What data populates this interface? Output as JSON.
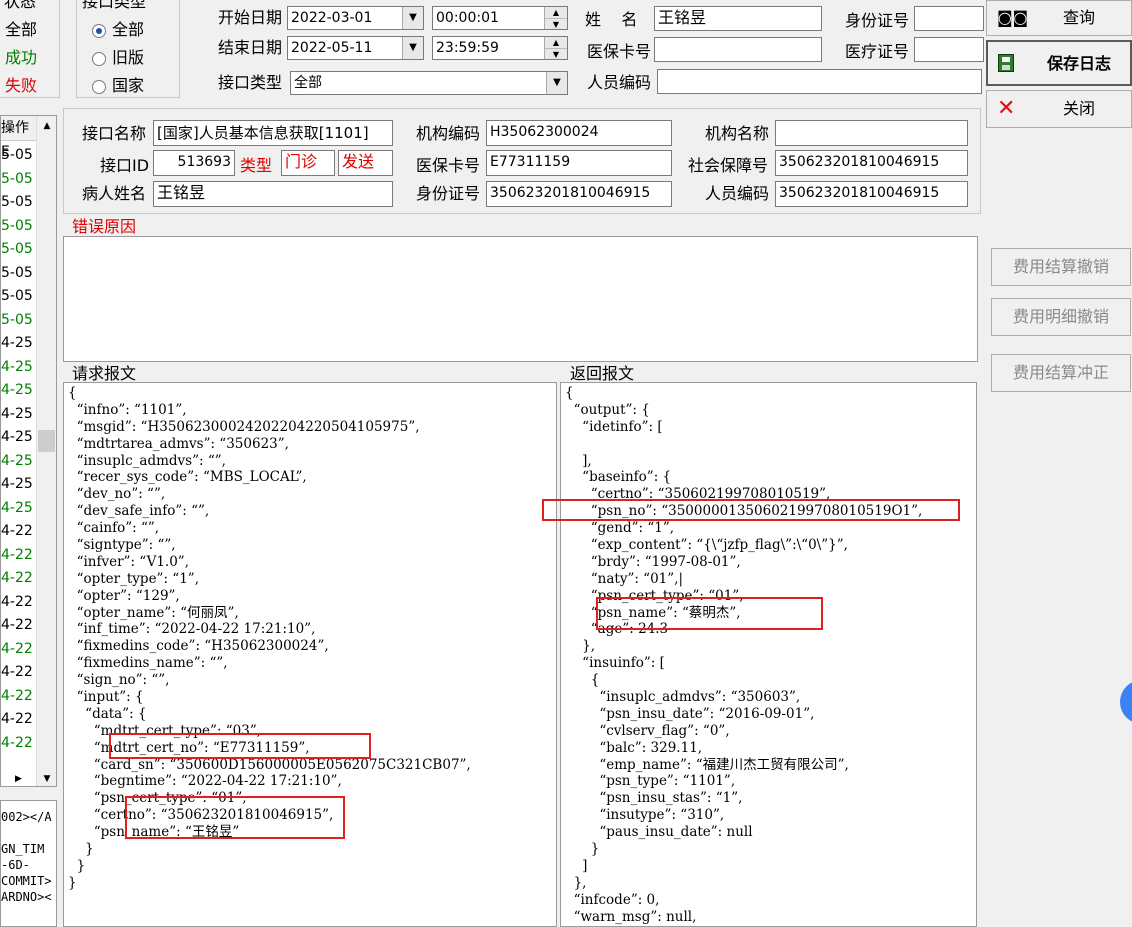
{
  "filter": {
    "status_title": "状态",
    "status_items": [
      "全部",
      "成功",
      "失败"
    ],
    "api_type_title": "接口类型",
    "api_type_options": [
      "全部",
      "旧版",
      "国家"
    ],
    "start_date_label": "开始日期",
    "start_date": "2022-03-01",
    "start_time": "00:00:01",
    "end_date_label": "结束日期",
    "end_date": "2022-05-11",
    "end_time": "23:59:59",
    "api_kind_label": "接口类型",
    "api_kind_value": "全部",
    "name_label": "姓    名",
    "name_value": "王铭昱",
    "card_label": "医保卡号",
    "card_value": "",
    "person_no_label": "人员编码",
    "person_no_value": "",
    "idcard_label": "身份证号",
    "idcard_value": "",
    "medcert_label": "医疗证号",
    "medcert_value": ""
  },
  "toolbar": {
    "query_label": "查询",
    "save_log_label": "保存日志",
    "close_label": "关闭",
    "cancel_settle_label": "费用结算撤销",
    "cancel_detail_label": "费用明细撤销",
    "settle_reverse_label": "费用结算冲正"
  },
  "list": {
    "header": "操作E",
    "rows": [
      {
        "text": "5-05",
        "color": "#000000"
      },
      {
        "text": "5-05",
        "color": "#008000"
      },
      {
        "text": "5-05",
        "color": "#000000"
      },
      {
        "text": "5-05",
        "color": "#008000"
      },
      {
        "text": "5-05",
        "color": "#008000"
      },
      {
        "text": "5-05",
        "color": "#000000"
      },
      {
        "text": "5-05",
        "color": "#000000"
      },
      {
        "text": "5-05",
        "color": "#008000"
      },
      {
        "text": "4-25",
        "color": "#000000"
      },
      {
        "text": "4-25",
        "color": "#008000"
      },
      {
        "text": "4-25",
        "color": "#008000"
      },
      {
        "text": "4-25",
        "color": "#000000"
      },
      {
        "text": "4-25",
        "color": "#000000"
      },
      {
        "text": "4-25",
        "color": "#008000"
      },
      {
        "text": "4-25",
        "color": "#000000"
      },
      {
        "text": "4-25",
        "color": "#008000"
      },
      {
        "text": "4-22",
        "color": "#000000"
      },
      {
        "text": "4-22",
        "color": "#008000"
      },
      {
        "text": "4-22",
        "color": "#008000"
      },
      {
        "text": "4-22",
        "color": "#000000"
      },
      {
        "text": "4-22",
        "color": "#000000"
      },
      {
        "text": "4-22",
        "color": "#008000"
      },
      {
        "text": "4-22",
        "color": "#000000"
      },
      {
        "text": "4-22",
        "color": "#008000"
      },
      {
        "text": "4-22",
        "color": "#000000"
      },
      {
        "text": "4-22",
        "color": "#008000"
      }
    ],
    "fragment_lines": [
      "002></A",
      "",
      "GN_TIM",
      "-6D-",
      "COMMIT>",
      "ARDNO><"
    ]
  },
  "detail": {
    "api_name_label": "接口名称",
    "api_name_value": "[国家]人员基本信息获取[1101]",
    "org_code_label": "机构编码",
    "org_code_value": "H35062300024",
    "org_name_label": "机构名称",
    "org_name_value": "",
    "api_id_label": "接口ID",
    "api_id_value": "513693",
    "type_label": "类型",
    "type_value1": "门诊",
    "type_value2": "发送",
    "card_no_label": "医保卡号",
    "card_no_value": "E77311159",
    "ssn_label": "社会保障号",
    "ssn_value": "350623201810046915",
    "patient_label": "病人姓名",
    "patient_value": "王铭昱",
    "idcard_label": "身份证号",
    "idcard_value": "350623201810046915",
    "person_no_label": "人员编码",
    "person_no_value": "350623201810046915",
    "error_title": "错误原因",
    "error_text": ""
  },
  "request": {
    "title": "请求报文",
    "lines": [
      "{",
      "  “infno”: “1101”,",
      "  “msgid”: “H35062300024202204220504105975”,",
      "  “mdtrtarea_admvs”: “350623”,",
      "  “insuplc_admdvs”: “”,",
      "  “recer_sys_code”: “MBS_LOCAL”,",
      "  “dev_no”: “”,",
      "  “dev_safe_info”: “”,",
      "  “cainfo”: “”,",
      "  “signtype”: “”,",
      "  “infver”: “V1.0”,",
      "  “opter_type”: “1”,",
      "  “opter”: “129”,",
      "  “opter_name”: “何丽凤”,",
      "  “inf_time”: “2022-04-22 17:21:10”,",
      "  “fixmedins_code”: “H35062300024”,",
      "  “fixmedins_name”: “”,",
      "  “sign_no”: “”,",
      "  “input”: {",
      "    “data”: {",
      "      “mdtrt_cert_type”: “03”,",
      "      “mdtrt_cert_no”: “E77311159”,",
      "      “card_sn”: “350600D156000005E0562075C321CB07”,",
      "      “begntime”: “2022-04-22 17:21:10”,",
      "      “psn_cert_type”: “01”,",
      "      “certno”: “350623201810046915”,",
      "      “psn_name”: “王铭昱”",
      "    }",
      "  }",
      "}"
    ]
  },
  "response": {
    "title": "返回报文",
    "lines": [
      "{",
      "  “output”: {",
      "    “idetinfo”: [",
      "",
      "    ],",
      "    “baseinfo”: {",
      "      “certno”: “350602199708010519”,",
      "      “psn_no”: “35000001350602199708010519O1”,",
      "      “gend”: “1”,",
      "      “exp_content”: “{\\“jzfp_flag\\”:\\“0\\”}”,",
      "      “brdy”: “1997-08-01”,",
      "      “naty”: “01”,|",
      "      “psn_cert_type”: “01”,",
      "      “psn_name”: “蔡明杰”,",
      "      “age”: 24.3",
      "    },",
      "    “insuinfo”: [",
      "      {",
      "        “insuplc_admdvs”: “350603”,",
      "        “psn_insu_date”: “2016-09-01”,",
      "        “cvlserv_flag”: “0”,",
      "        “balc”: 329.11,",
      "        “emp_name”: “福建川杰工贸有限公司”,",
      "        “psn_type”: “1101”,",
      "        “psn_insu_stas”: “1”,",
      "        “insutype”: “310”,",
      "        “paus_insu_date”: null",
      "      }",
      "    ]",
      "  },",
      "  “infcode”: 0,",
      "  “warn_msg”: null,"
    ]
  }
}
